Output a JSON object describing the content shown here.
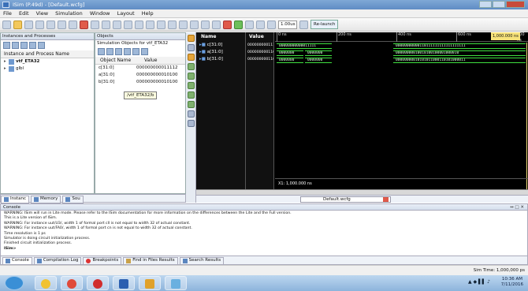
{
  "window": {
    "title": "ISim (P.49d) - [Default.wcfg]"
  },
  "menu": [
    "File",
    "Edit",
    "View",
    "Simulation",
    "Window",
    "Layout",
    "Help"
  ],
  "toolbar": {
    "time_value": "1.00us",
    "relaunch_label": "Re-launch"
  },
  "instances_panel": {
    "title": "Instances and Processes",
    "col_header": "Instance and Process Name",
    "rows": [
      {
        "name": "vtf_ETA32"
      },
      {
        "name": "glbl"
      }
    ]
  },
  "objects_panel": {
    "title": "Objects",
    "subtitle": "Simulation Objects for vtf_ETA32",
    "col_name": "Object Name",
    "col_value": "Value",
    "rows": [
      {
        "name": "c[31:0]",
        "value": "000000000011112"
      },
      {
        "name": "a[31:0]",
        "value": "000000000010100"
      },
      {
        "name": "b[31:0]",
        "value": "000000000010100"
      }
    ],
    "tooltip": "/vtf_ETA32/b"
  },
  "wave": {
    "name_header": "Name",
    "value_header": "Value",
    "time_cursor_label": "1,000.000 ns",
    "ticks": [
      "0 ns",
      "200 ns",
      "400 ns",
      "600 ns",
      "800 ns"
    ],
    "signals": [
      {
        "name": "c[31:0]",
        "value": "000000000111",
        "seg1": "00000000000011111",
        "seg2": "00000000000110111111111111111111"
      },
      {
        "name": "a[31:0]",
        "value": "000000000110",
        "seg1": "0000000",
        "seg1b": "0000000",
        "seg2": "00000000010010100100001000010"
      },
      {
        "name": "b[31:0]",
        "value": "000000000110",
        "seg1": "0000000",
        "seg1b": "0000000",
        "seg2": "00000000010101011000110101000011"
      }
    ],
    "cursor_readout": "X1: 1,000.000 ns",
    "tab_label": "Default.wcfg"
  },
  "left_tabs": [
    "Instanc",
    "Memory",
    "Sou"
  ],
  "console": {
    "title": "Console",
    "lines": [
      "WARNING: ISim will run in Lite mode. Please refer to the ISim documentation for more information on the differences between the Lite and the Full version.",
      "This is a Lite version of ISim.",
      "WARNING: For instance uut/U3/, width 1 of formal port cll is not equal to width 32 of actual constant.",
      "WARNING: For instance uut/FA0/, width 1 of formal port cn is not equal to width 32 of actual constant.",
      "Time resolution is 1 ps",
      "Simulator is doing circuit initialization process.",
      "Finished circuit initialization process.",
      "ISim>"
    ]
  },
  "bottom_tabs": [
    "Console",
    "Compilation Log",
    "Breakpoints",
    "Find in Files Results",
    "Search Results"
  ],
  "status": {
    "sim_time": "Sim Time: 1,000,000 ps"
  },
  "taskbar": {
    "time": "10:36 AM",
    "date": "7/11/2016"
  }
}
